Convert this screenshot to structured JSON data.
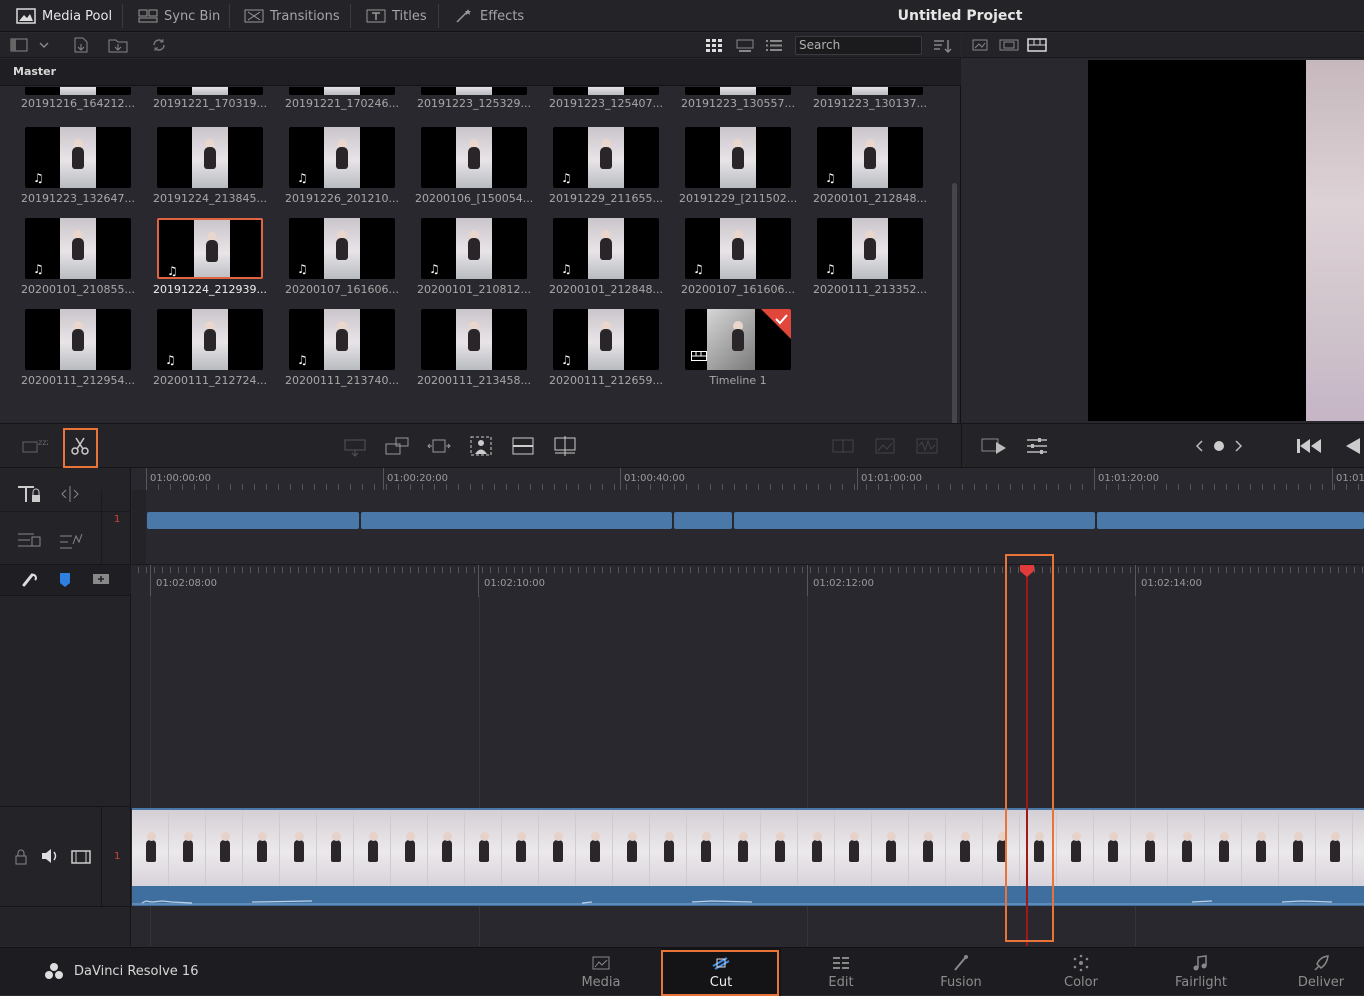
{
  "app": {
    "name": "DaVinci Resolve 16",
    "project_title": "Untitled Project"
  },
  "top_tabs": [
    {
      "label": "Media Pool",
      "icon": "media-pool-icon"
    },
    {
      "label": "Sync Bin",
      "icon": "sync-bin-icon"
    },
    {
      "label": "Transitions",
      "icon": "transitions-icon"
    },
    {
      "label": "Titles",
      "icon": "titles-icon"
    },
    {
      "label": "Effects",
      "icon": "effects-icon"
    }
  ],
  "media_pool": {
    "search_placeholder": "Search",
    "bin_name": "Master",
    "top_row_names": [
      "20191216_164212...",
      "20191221_170319...",
      "20191221_170246...",
      "20191223_125329...",
      "20191223_125407...",
      "20191223_130557...",
      "20191223_130137..."
    ],
    "clips": [
      {
        "name": "20191223_132647...",
        "audio": true
      },
      {
        "name": "20191224_213845...",
        "audio": false
      },
      {
        "name": "20191226_201210...",
        "audio": true
      },
      {
        "name": "20200106_[150054...",
        "audio": false
      },
      {
        "name": "20191229_211655...",
        "audio": true
      },
      {
        "name": "20191229_[211502...",
        "audio": false
      },
      {
        "name": "20200101_212848...",
        "audio": true
      },
      {
        "name": "20200101_210855...",
        "audio": true
      },
      {
        "name": "20191224_212939...",
        "audio": true,
        "selected": true
      },
      {
        "name": "20200107_161606...",
        "audio": true
      },
      {
        "name": "20200101_210812...",
        "audio": true
      },
      {
        "name": "20200101_212848...",
        "audio": true
      },
      {
        "name": "20200107_161606...",
        "audio": true
      },
      {
        "name": "20200111_213352...",
        "audio": true
      },
      {
        "name": "20200111_212954...",
        "audio": false
      },
      {
        "name": "20200111_212724...",
        "audio": true
      },
      {
        "name": "20200111_213740...",
        "audio": true
      },
      {
        "name": "20200111_213458...",
        "audio": false
      },
      {
        "name": "20200111_212659...",
        "audio": true
      },
      {
        "name": "Timeline 1",
        "audio": false,
        "timeline": true
      }
    ]
  },
  "timeline": {
    "upper_timecodes": [
      "01:00:00:00",
      "01:00:20:00",
      "01:00:40:00",
      "01:01:00:00",
      "01:01:20:00",
      "01:01"
    ],
    "lower_timecodes": [
      "01:02:08:00",
      "01:02:10:00",
      "01:02:12:00",
      "01:02:14:00"
    ],
    "track_number": "1"
  },
  "pages": [
    {
      "label": "Media",
      "icon": "media-page-icon"
    },
    {
      "label": "Cut",
      "icon": "cut-page-icon",
      "active": true
    },
    {
      "label": "Edit",
      "icon": "edit-page-icon"
    },
    {
      "label": "Fusion",
      "icon": "fusion-page-icon"
    },
    {
      "label": "Color",
      "icon": "color-page-icon"
    },
    {
      "label": "Fairlight",
      "icon": "fairlight-page-icon"
    },
    {
      "label": "Deliver",
      "icon": "deliver-page-icon"
    }
  ],
  "colors": {
    "accent": "#e8743a",
    "clip_blue": "#4a78a8",
    "playhead": "#e03a3a"
  }
}
